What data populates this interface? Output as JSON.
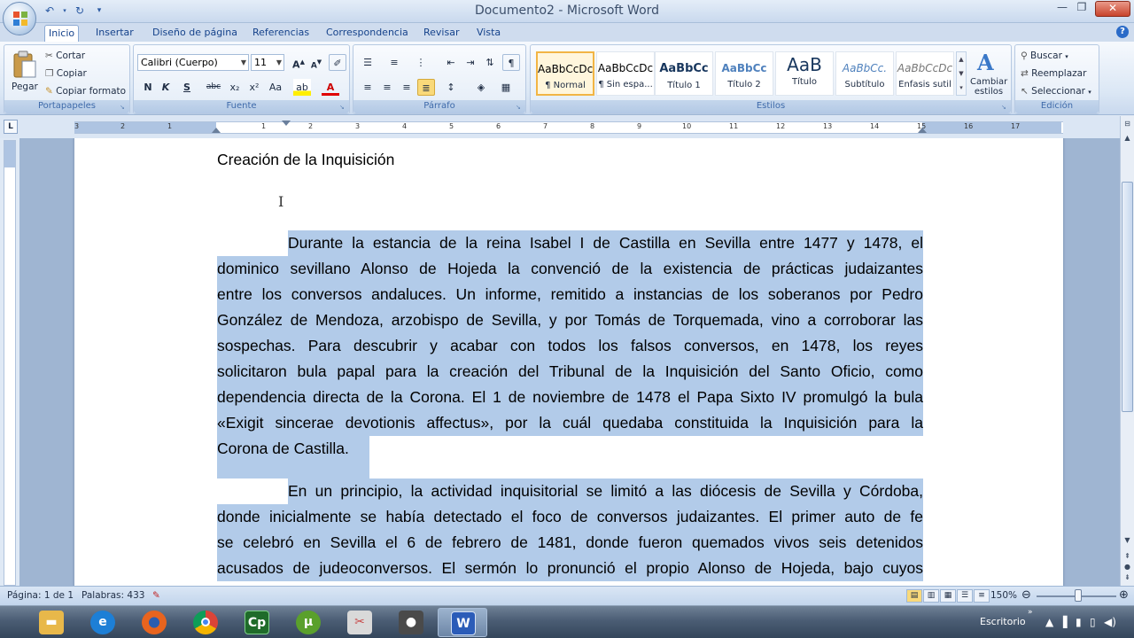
{
  "window": {
    "title": "Documento2 - Microsoft Word"
  },
  "tabs": [
    "Inicio",
    "Insertar",
    "Diseño de página",
    "Referencias",
    "Correspondencia",
    "Revisar",
    "Vista"
  ],
  "ribbon": {
    "clipboard": {
      "label": "Portapapeles",
      "paste": "Pegar",
      "cut": "Cortar",
      "copy": "Copiar",
      "format_painter": "Copiar formato"
    },
    "font": {
      "label": "Fuente",
      "family": "Calibri (Cuerpo)",
      "size": "11",
      "bold": "N",
      "italic": "K",
      "underline": "S",
      "strike": "abc",
      "subscript": "x₂",
      "superscript": "x²",
      "change_case": "Aa"
    },
    "paragraph": {
      "label": "Párrafo"
    },
    "styles": {
      "label": "Estilos",
      "items": [
        {
          "sample": "AaBbCcDc",
          "name": "¶ Normal"
        },
        {
          "sample": "AaBbCcDc",
          "name": "¶ Sin espa..."
        },
        {
          "sample": "AaBbCc",
          "name": "Título 1"
        },
        {
          "sample": "AaBbCc",
          "name": "Título 2"
        },
        {
          "sample": "AaB",
          "name": "Título"
        },
        {
          "sample": "AaBbCc.",
          "name": "Subtítulo"
        },
        {
          "sample": "AaBbCcDc",
          "name": "Énfasis sutil"
        }
      ],
      "change_styles": "Cambiar estilos"
    },
    "editing": {
      "label": "Edición",
      "find": "Buscar",
      "replace": "Reemplazar",
      "select": "Seleccionar"
    }
  },
  "ruler": {
    "ticks": [
      "3",
      "2",
      "1",
      "1",
      "2",
      "3",
      "4",
      "5",
      "6",
      "7",
      "8",
      "9",
      "10",
      "11",
      "12",
      "13",
      "14",
      "15",
      "16",
      "17"
    ]
  },
  "document": {
    "heading": "Creación de la Inquisición",
    "paragraph1": [
      "Durante la estancia de la reina Isabel I de Castilla en Sevilla entre 1477 y 1478, el",
      "dominico sevillano Alonso de Hojeda la convenció de la existencia de prácticas judaizantes",
      "entre los conversos andaluces. Un informe, remitido a instancias de los soberanos por Pedro",
      "González de Mendoza, arzobispo de Sevilla, y por Tomás de Torquemada, vino a corroborar las",
      "sospechas. Para descubrir y acabar con todos los falsos conversos, en 1478, los reyes",
      "solicitaron bula papal para la creación del Tribunal de la Inquisición del Santo Oficio, como",
      "dependencia directa de la Corona. El 1 de noviembre de 1478 el Papa Sixto IV promulgó la bula",
      "«Exigit sincerae devotionis affectus», por la cuál quedaba constituida la Inquisición para la",
      "Corona de Castilla."
    ],
    "paragraph2": [
      "En un principio, la actividad inquisitorial se limitó a las diócesis de Sevilla y Córdoba,",
      "donde inicialmente se había detectado el foco de conversos judaizantes. El primer auto de fe",
      "se celebró en Sevilla el 6 de febrero de 1481, donde fueron quemados vivos seis detenidos",
      "acusados de judeoconversos. El sermón lo pronunció el propio Alonso de Hojeda, bajo cuyos"
    ]
  },
  "statusbar": {
    "page": "Página: 1 de 1",
    "words": "Palabras: 433",
    "zoom": "150%"
  },
  "taskbar": {
    "apps": [
      {
        "icon": "folder-icon",
        "color": "#e8b84a"
      },
      {
        "icon": "internet-explorer-icon",
        "color": "#1d7fd6"
      },
      {
        "icon": "firefox-icon",
        "color": "#e8641e"
      },
      {
        "icon": "chrome-icon",
        "color": "#3aa757"
      },
      {
        "icon": "captivate-icon",
        "color": "#1f6b2a"
      },
      {
        "icon": "utorrent-icon",
        "color": "#5aa02c"
      },
      {
        "icon": "snipping-tool-icon",
        "color": "#c84848"
      },
      {
        "icon": "recorder-icon",
        "color": "#4a4a4a"
      },
      {
        "icon": "word-icon",
        "color": "#2b5cb8"
      }
    ],
    "desktop_label": "Escritorio"
  }
}
